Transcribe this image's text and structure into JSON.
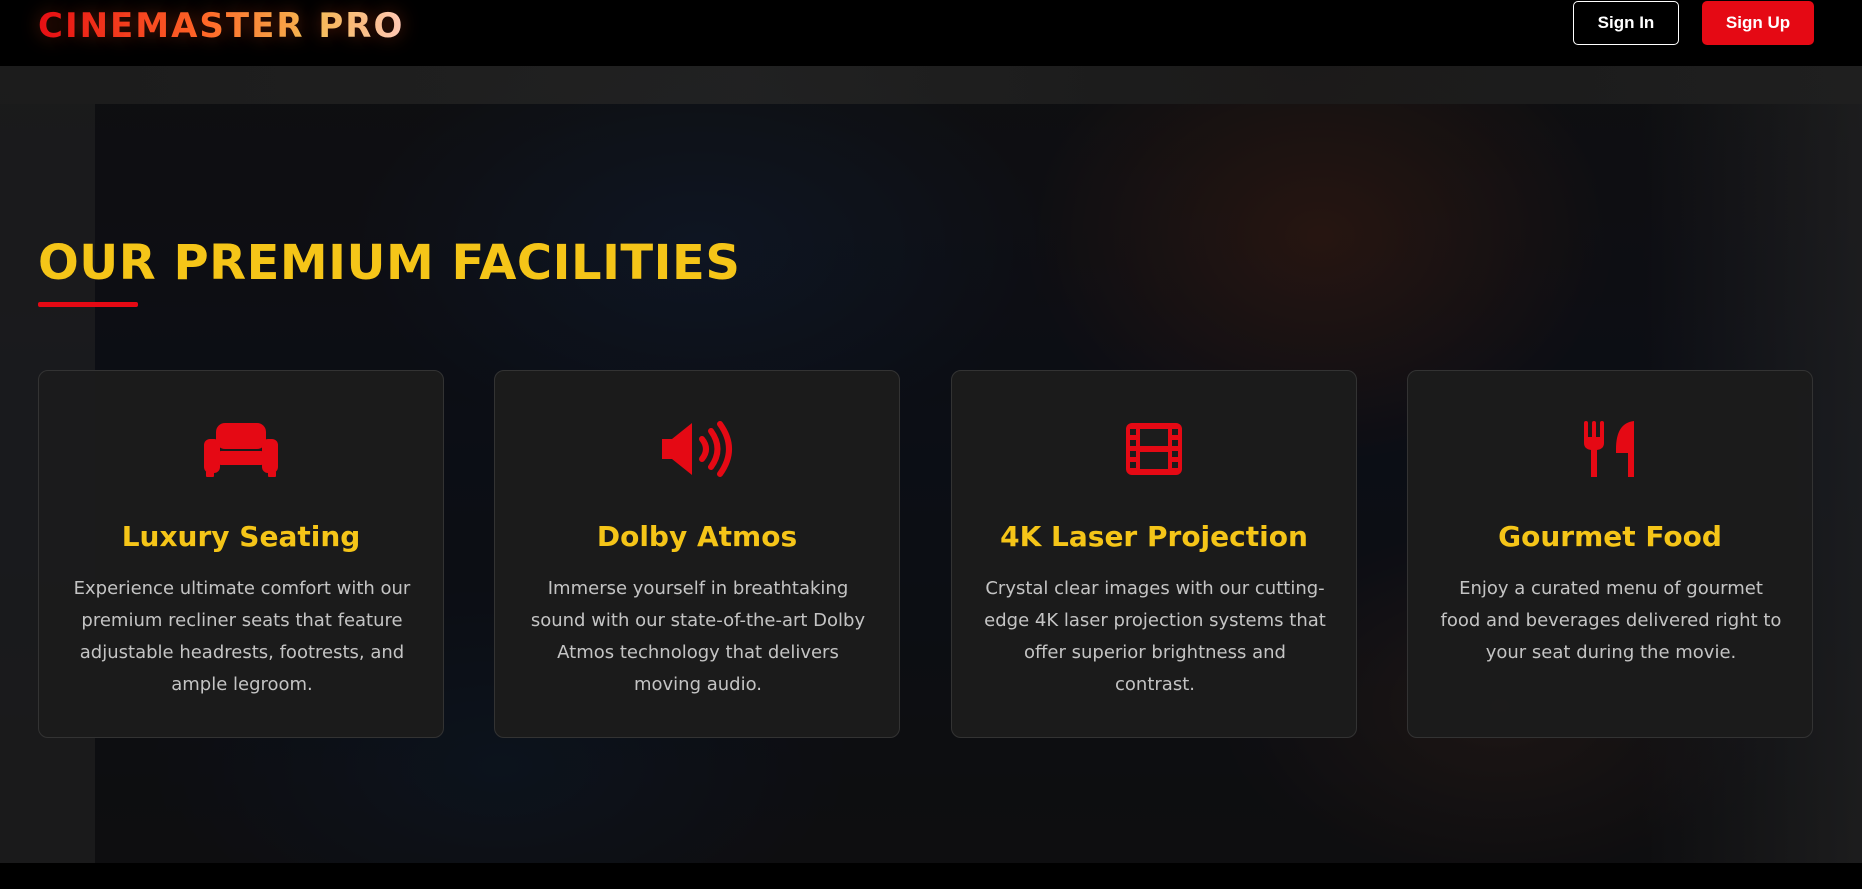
{
  "header": {
    "logo": "CINEMASTER PRO",
    "signin_label": "Sign In",
    "signup_label": "Sign Up"
  },
  "facilities": {
    "title": "OUR PREMIUM FACILITIES",
    "cards": [
      {
        "icon": "couch-icon",
        "title": "Luxury Seating",
        "description": "Experience ultimate comfort with our premium recliner seats that feature adjustable headrests, footrests, and ample legroom."
      },
      {
        "icon": "volume-high-icon",
        "title": "Dolby Atmos",
        "description": "Immerse yourself in breathtaking sound with our state-of-the-art Dolby Atmos technology that delivers moving audio."
      },
      {
        "icon": "film-icon",
        "title": "4K Laser Projection",
        "description": "Crystal clear images with our cutting-edge 4K laser projection systems that offer superior brightness and contrast."
      },
      {
        "icon": "utensils-icon",
        "title": "Gourmet Food",
        "description": "Enjoy a curated menu of gourmet food and beverages delivered right to your seat during the movie."
      }
    ]
  },
  "colors": {
    "accent_red": "#e50914",
    "accent_yellow": "#f5c518",
    "card_bg": "#1c1c1c",
    "text_muted": "#c4c4c4"
  }
}
